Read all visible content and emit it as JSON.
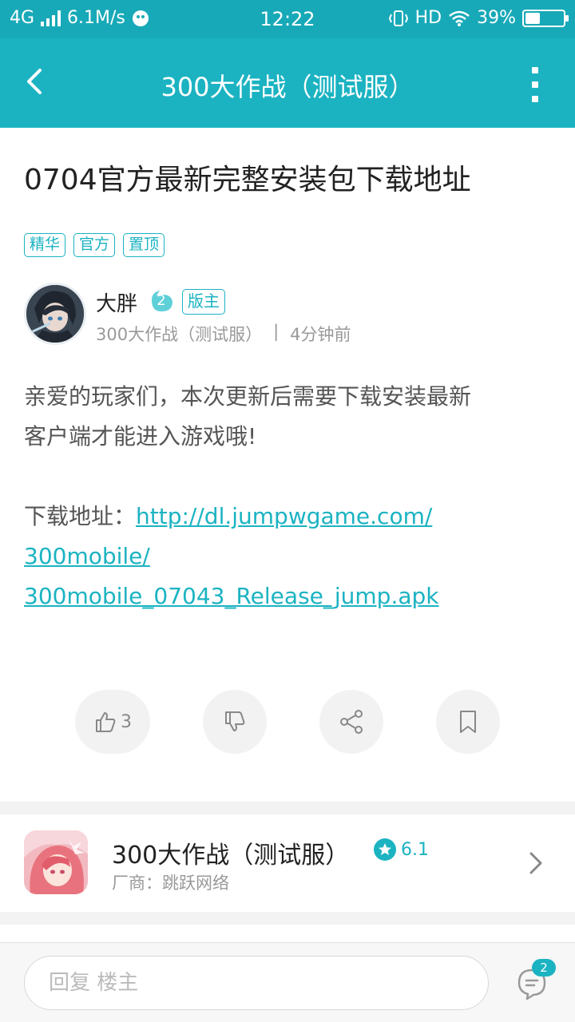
{
  "status_bar": {
    "network": "4G",
    "speed": "6.1M/s",
    "time": "12:22",
    "hd": "HD",
    "battery_text": "39%",
    "battery_level": 0.39
  },
  "app_bar": {
    "title": "300大作战（测试服）",
    "back_icon": "back-arrow-icon",
    "more_icon": "more-vertical-icon"
  },
  "post": {
    "title": "0704官方最新完整安装包下载地址",
    "tags": [
      "精华",
      "官方",
      "置顶"
    ],
    "author": {
      "name": "大胖",
      "level": "2",
      "role": "版主",
      "forum": "300大作战（测试服）",
      "separator": "|",
      "time": "4分钟前"
    },
    "body_line_1": "亲爱的玩家们，本次更新后需要下载安装最新",
    "body_line_2": "客户端才能进入游戏哦!",
    "download_label": "下载地址：",
    "link_line_1": "http://dl.jumpwgame.com/",
    "link_line_2": "300mobile/",
    "link_line_3": "300mobile_07043_Release_jump.apk"
  },
  "actions": {
    "like_count": "3",
    "like_icon": "thumbs-up-icon",
    "dislike_icon": "thumbs-down-icon",
    "share_icon": "share-icon",
    "bookmark_icon": "bookmark-icon"
  },
  "game_card": {
    "name": "300大作战（测试服）",
    "rating": "6.1",
    "vendor": "厂商：跳跃网络"
  },
  "bottom_bar": {
    "reply_placeholder": "回复  楼主",
    "comment_count": "2"
  },
  "colors": {
    "accent": "#1bb3c2",
    "status_bar": "#18a9b8"
  }
}
